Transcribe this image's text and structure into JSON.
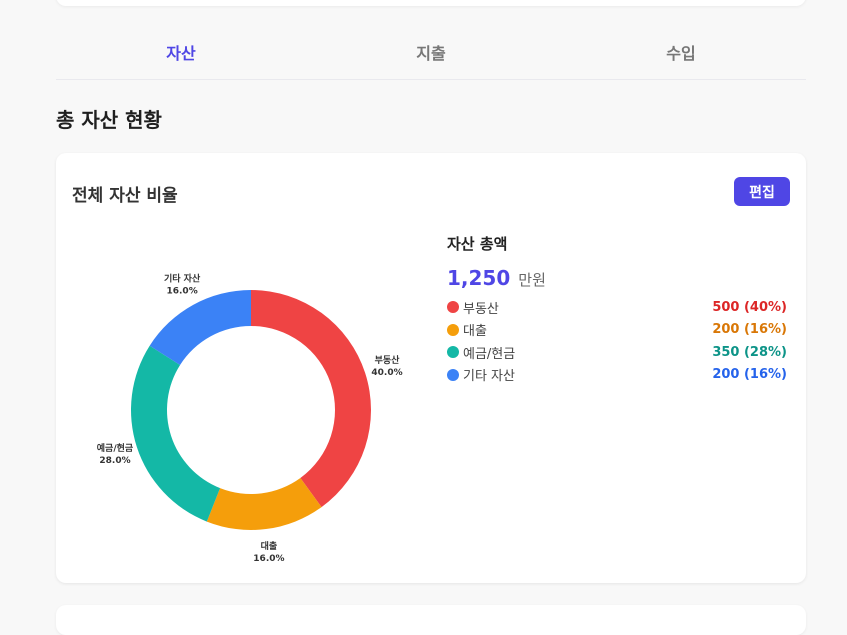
{
  "tabs": [
    {
      "label": "자산",
      "active": true
    },
    {
      "label": "지출",
      "active": false
    },
    {
      "label": "수입",
      "active": false
    }
  ],
  "section_title": "총 자산 현황",
  "card": {
    "title": "전체 자산 비율",
    "edit_label": "편집"
  },
  "summary": {
    "label": "자산 총액",
    "amount": "1,250",
    "unit": "만원"
  },
  "chart_data": {
    "type": "pie",
    "donut": true,
    "total": 1250,
    "slices": [
      {
        "name": "부동산",
        "value": 500,
        "percent": 40.0,
        "color": "#ef4444",
        "chart_label": "40.0%",
        "legend_value": "500 (40%)",
        "value_color": "#dc2626"
      },
      {
        "name": "대출",
        "value": 200,
        "percent": 16.0,
        "color": "#f59e0b",
        "chart_label": "16.0%",
        "legend_value": "200 (16%)",
        "value_color": "#d97706"
      },
      {
        "name": "예금/현금",
        "value": 350,
        "percent": 28.0,
        "color": "#14b8a6",
        "chart_label": "28.0%",
        "legend_value": "350 (28%)",
        "value_color": "#0d9488"
      },
      {
        "name": "기타 자산",
        "value": 200,
        "percent": 16.0,
        "color": "#3b82f6",
        "chart_label": "16.0%",
        "legend_value": "200 (16%)",
        "value_color": "#2563eb"
      }
    ]
  }
}
